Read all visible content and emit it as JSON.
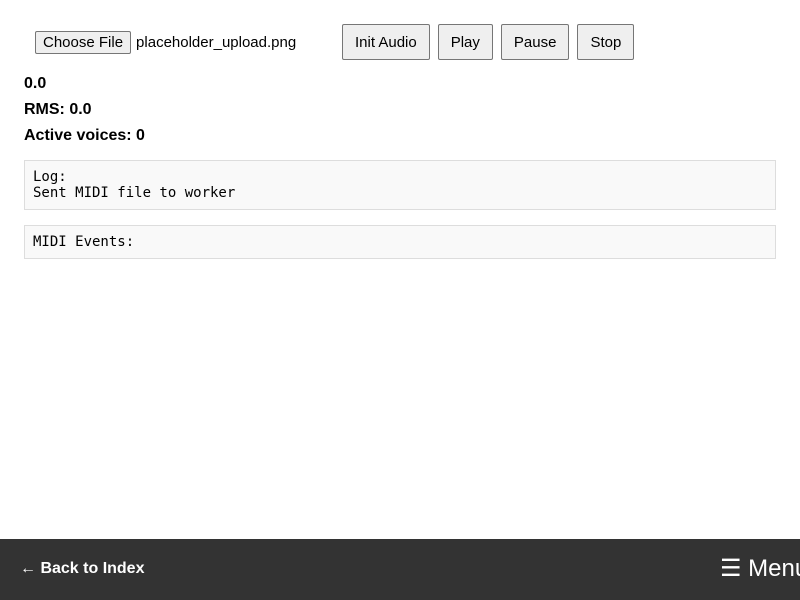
{
  "toolbar": {
    "choose_file_label": "Choose File",
    "file_name": "placeholder_upload.png",
    "init_audio_label": "Init Audio",
    "play_label": "Play",
    "pause_label": "Pause",
    "stop_label": "Stop"
  },
  "stats": {
    "value": "0.0",
    "rms": "RMS: 0.0",
    "active_voices": "Active voices: 0"
  },
  "log": {
    "text": "Log:\nSent MIDI file to worker"
  },
  "midi_events": {
    "text": "MIDI Events:"
  },
  "footer": {
    "back_label": "← Back to Index",
    "menu_label": "☰ Menu"
  },
  "colors": {
    "footer_bg": "#333333",
    "panel_bg": "#f9f9f9"
  }
}
